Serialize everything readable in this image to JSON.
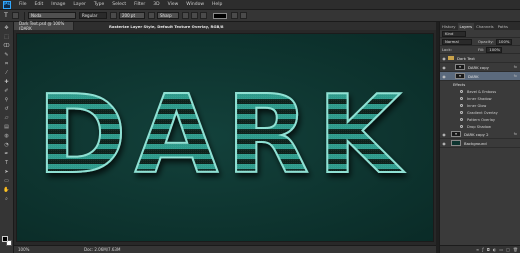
{
  "app": {
    "logo": "Ps"
  },
  "menu": [
    "File",
    "Edit",
    "Image",
    "Layer",
    "Type",
    "Select",
    "Filter",
    "3D",
    "View",
    "Window",
    "Help"
  ],
  "options": {
    "tool_glyph": "T",
    "font_family": "Noda",
    "font_style": "Regular",
    "font_size": "200 pt",
    "aa_mode": "Sharp",
    "color_hex": "#000000"
  },
  "document": {
    "tab": "Dark Text.psd @ 100% (DARK",
    "hint": "Rasterize Layer Style, Default Texture Overlay, RGB/8",
    "text": "DARK",
    "zoom": "100%",
    "doc_info": "Doc: 2.06M/7.63M"
  },
  "panels": {
    "tabs": [
      "History",
      "Layers",
      "Channels",
      "Paths"
    ],
    "kind_label": "Kind",
    "blend_mode": "Normal",
    "opacity_label": "Opacity:",
    "opacity_value": "100%",
    "lock_label": "Lock:",
    "fill_label": "Fill:",
    "fill_value": "100%",
    "layers": [
      {
        "name": "Dark Text",
        "type": "group"
      },
      {
        "name": "DARK copy",
        "thumb": "T",
        "fx": "fx"
      },
      {
        "name": "DARK",
        "thumb": "T",
        "fx": "fx",
        "selected": true
      }
    ],
    "effects_label": "Effects",
    "effects": [
      "Bevel & Emboss",
      "Inner Shadow",
      "Inner Glow",
      "Gradient Overlay",
      "Pattern Overlay",
      "Drop Shadow"
    ],
    "lower_layers": [
      {
        "name": "DARK copy 2",
        "thumb": "T",
        "fx": "fx"
      },
      {
        "name": "Background",
        "thumb": ""
      }
    ]
  },
  "colors": {
    "canvas": "#0e3530",
    "text_fill": "#2a8a7e",
    "text_stripe": "#08201d",
    "bevel": "#7fd4c8",
    "selected_layer": "#5b6a7d"
  }
}
